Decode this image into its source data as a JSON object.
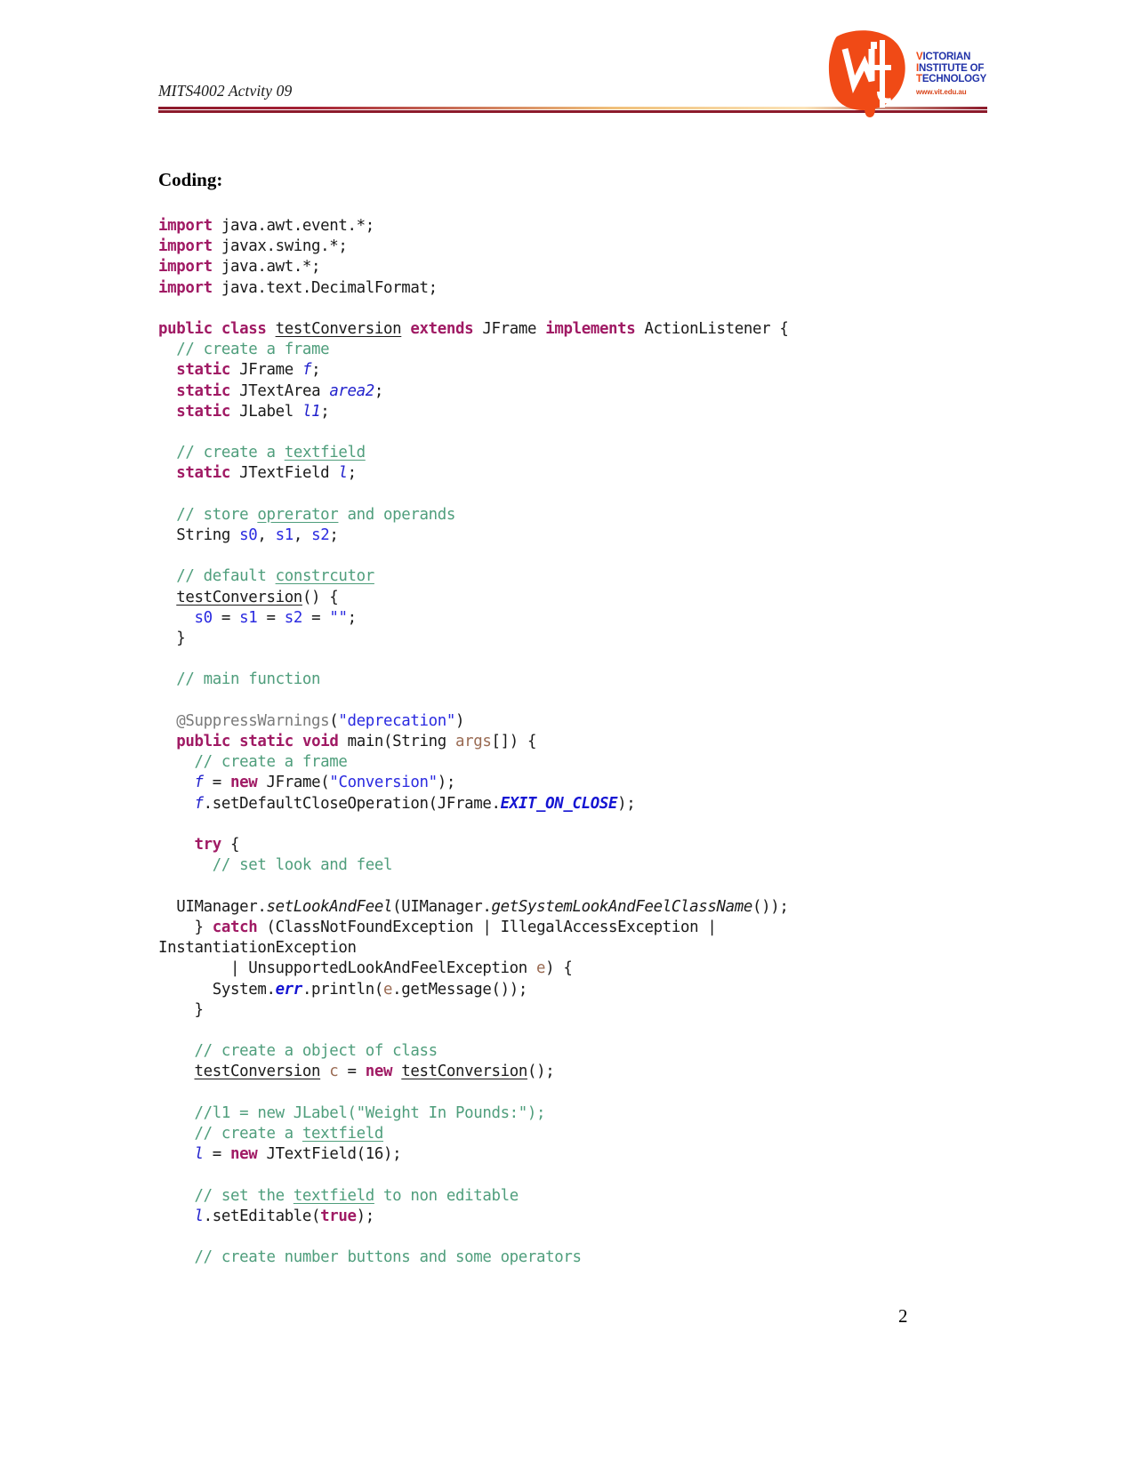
{
  "header": {
    "title": "MITS4002 Actvity 09",
    "rule_color_dark": "#8c1a2b",
    "rule_color_light": "#f5d9a8"
  },
  "logo": {
    "mark_color": "#f04a16",
    "text_color": "#2233a8",
    "line1": "VICTORIAN",
    "line2": "INSTITUTE OF",
    "line3": "TECHNOLOGY",
    "url": "www.vit.edu.au"
  },
  "content": {
    "heading": "Coding:"
  },
  "code": {
    "language": "java",
    "lines": [
      "import java.awt.event.*;",
      "import javax.swing.*;",
      "import java.awt.*;",
      "import java.text.DecimalFormat;",
      "",
      "public class testConversion extends JFrame implements ActionListener {",
      "  // create a frame",
      "  static JFrame f;",
      "  static JTextArea area2;",
      "  static JLabel l1;",
      "",
      "  // create a textfield",
      "  static JTextField l;",
      "",
      "  // store oprerator and operands",
      "  String s0, s1, s2;",
      "",
      "  // default constrcutor",
      "  testConversion() {",
      "    s0 = s1 = s2 = \"\";",
      "  }",
      "",
      "  // main function",
      "",
      "  @SuppressWarnings(\"deprecation\")",
      "  public static void main(String args[]) {",
      "    // create a frame",
      "    f = new JFrame(\"Conversion\");",
      "    f.setDefaultCloseOperation(JFrame.EXIT_ON_CLOSE);",
      "",
      "    try {",
      "      // set look and feel",
      "",
      "  UIManager.setLookAndFeel(UIManager.getSystemLookAndFeelClassName());",
      "    } catch (ClassNotFoundException | IllegalAccessException |",
      "InstantiationException",
      "        | UnsupportedLookAndFeelException e) {",
      "      System.err.println(e.getMessage());",
      "    }",
      "",
      "    // create a object of class",
      "    testConversion c = new testConversion();",
      "",
      "    //l1 = new JLabel(\"Weight In Pounds:\");",
      "    // create a textfield",
      "    l = new JTextField(16);",
      "",
      "    // set the textfield to non editable",
      "    l.setEditable(true);",
      "",
      "    // create number buttons and some operators"
    ],
    "misspelled_words": [
      "testConversion",
      "textfield",
      "oprerator",
      "constrcutor"
    ],
    "colors": {
      "keyword": "#a01a64",
      "comment": "#4f9e7c",
      "string": "#2a2ae0",
      "variable": "#2222cc",
      "constant": "#1414d2",
      "parameter": "#9a6b53",
      "annotation": "#7a7a7a",
      "plain": "#1a1a1a"
    }
  },
  "footer": {
    "page_number": "2"
  }
}
